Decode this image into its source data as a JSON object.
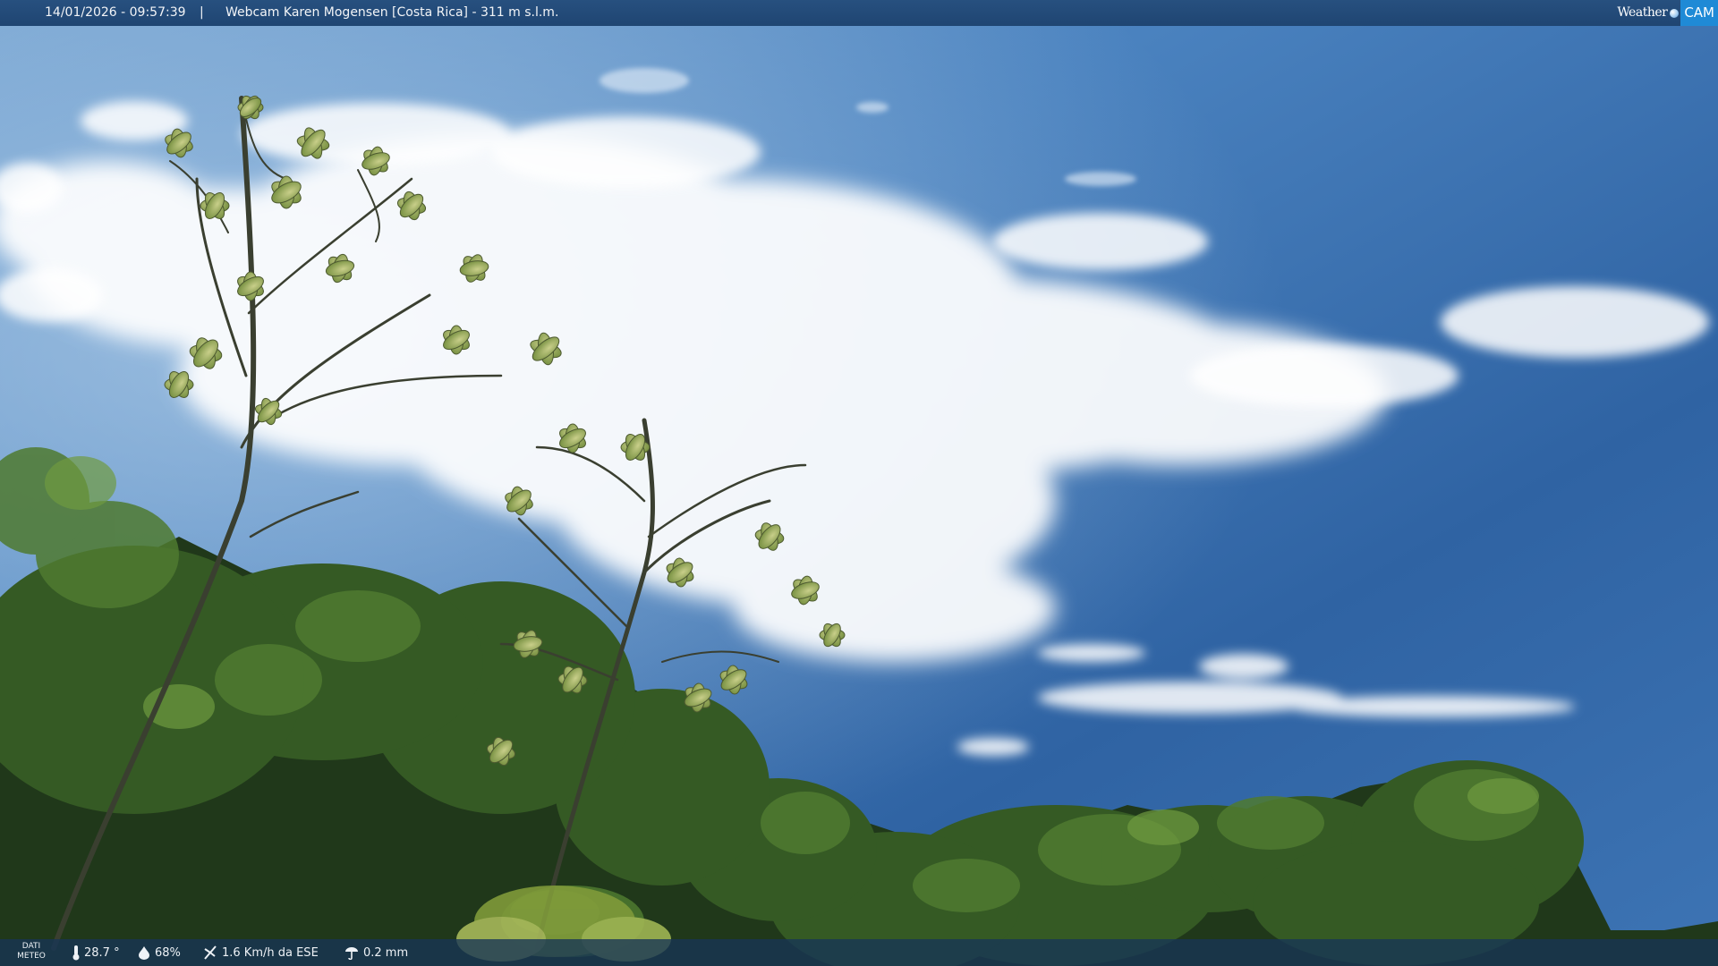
{
  "overlay_header": {
    "timestamp": "14/01/2026 - 09:57:39",
    "separator": "|",
    "title": "Webcam Karen Mogensen [Costa Rica] - 311 m s.l.m."
  },
  "logo": {
    "weather_text": "Weather",
    "cam_text": "CAM"
  },
  "weather_data": {
    "label_line1": "DATI",
    "label_line2": "METEO",
    "temperature": "28.7 °",
    "humidity": "68%",
    "wind": "1.6 Km/h da ESE",
    "rain": "0.2 mm"
  },
  "colors": {
    "sky_top": "#2f5f9f",
    "sky_bottom": "#4f87c4",
    "foliage_dark": "#1d3212",
    "foliage_light": "#8fa15a",
    "bar_bg": "#1f4572"
  },
  "icons": {
    "temperature": "thermometer-icon",
    "humidity": "droplet-icon",
    "wind": "wind-icon",
    "rain": "rain-gauge-icon"
  }
}
